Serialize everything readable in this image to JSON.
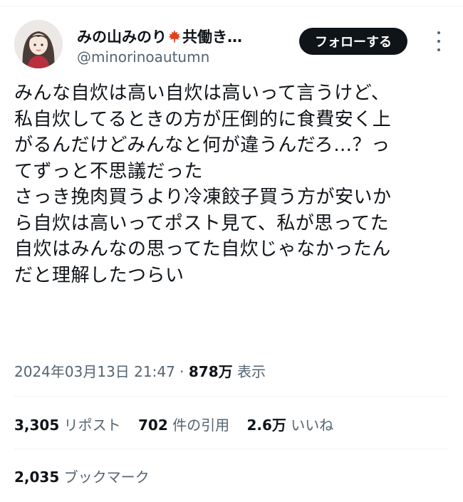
{
  "author": {
    "display_name": "みの山みのり",
    "display_name_suffix": "共働き…",
    "handle": "@minorinoautumn",
    "avatar_icon": "avatar-illustration-icon",
    "emoji_icon": "maple-leaf-icon"
  },
  "follow_button": {
    "label": "フォローする"
  },
  "more_icon": "more-vertical-icon",
  "tweet": {
    "lines": [
      "みんな自炊は高い自炊は高いって言うけど、",
      "私自炊してるときの方が圧倒的に食費安く上",
      "がるんだけどみんなと何が違うんだろ…？っ",
      "てずっと不思議だった",
      "さっき挽肉買うより冷凍餃子買う方が安いか",
      "ら自炊は高いってポスト見て、私が思ってた",
      "自炊はみんなの思ってた自炊じゃなかったん",
      "だと理解したつらい"
    ]
  },
  "meta": {
    "timestamp": "2024年03月13日 21:47",
    "dot": "·",
    "views_count": "878万",
    "views_label": "表示"
  },
  "stats": {
    "reposts": {
      "count": "3,305",
      "label": "リポスト"
    },
    "quotes": {
      "count": "702",
      "label": "件の引用"
    },
    "likes": {
      "count": "2.6万",
      "label": "いいね"
    },
    "bookmarks": {
      "count": "2,035",
      "label": "ブックマーク"
    }
  },
  "colors": {
    "text_primary": "#0f1419",
    "text_secondary": "#536471",
    "divider": "#eff3f4",
    "button_bg": "#0f1419"
  }
}
